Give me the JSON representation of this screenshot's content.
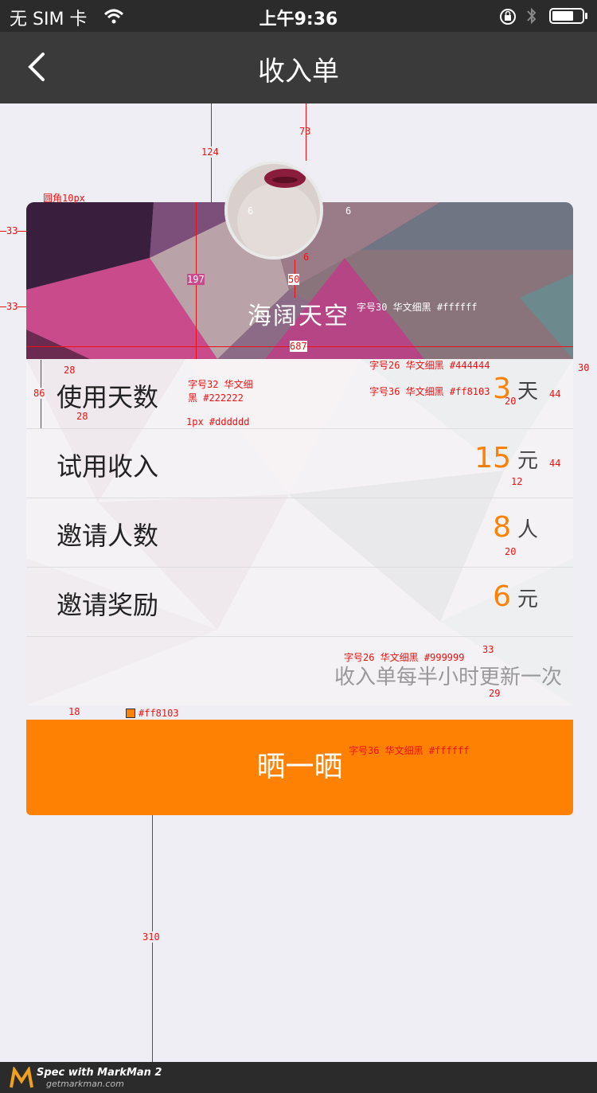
{
  "status_bar": {
    "carrier": "无 SIM 卡",
    "time": "上午9:36"
  },
  "nav": {
    "title": "收入单"
  },
  "profile": {
    "name": "海阔天空"
  },
  "rows": [
    {
      "label": "使用天数",
      "value": "3",
      "unit": "天"
    },
    {
      "label": "试用收入",
      "value": "15",
      "unit": "元"
    },
    {
      "label": "邀请人数",
      "value": "8",
      "unit": "人"
    },
    {
      "label": "邀请奖励",
      "value": "6",
      "unit": "元"
    }
  ],
  "note": "收入单每半小时更新一次",
  "button": {
    "label": "晒一晒"
  },
  "colors": {
    "accent": "#ff8103",
    "label": "#222222",
    "unit": "#444444",
    "note": "#999999",
    "divider": "#dddddd"
  },
  "annotations": {
    "a124": "124",
    "a73": "73",
    "a33a": "33",
    "a33b": "33",
    "a197": "197",
    "a687": "687",
    "a6a": "6",
    "a6b": "6",
    "a6c": "6",
    "a50": "50",
    "a30": "30",
    "a28a": "28",
    "a28b": "28",
    "a86": "86",
    "a20a": "20",
    "a20b": "20",
    "a44a": "44",
    "a44b": "44",
    "a12": "12",
    "a33c": "33",
    "a29": "29",
    "a18": "18",
    "a310": "310",
    "radius": "圆角10px",
    "name_font": "字号30 华文细黑 #ffffff",
    "unit_font": "字号26 华文细黑 #444444",
    "num_font": "字号36 华文细黑 #ff8103",
    "label_font": "字号32 华文细黑 #222222",
    "divider": "1px #dddddd",
    "note_font": "字号26 华文细黑 #999999",
    "accent": "#ff8103",
    "btn_font": "字号36 华文细黑 #ffffff"
  },
  "footer": {
    "brand": "Spec with MarkMan 2",
    "site": "getmarkman.com"
  }
}
